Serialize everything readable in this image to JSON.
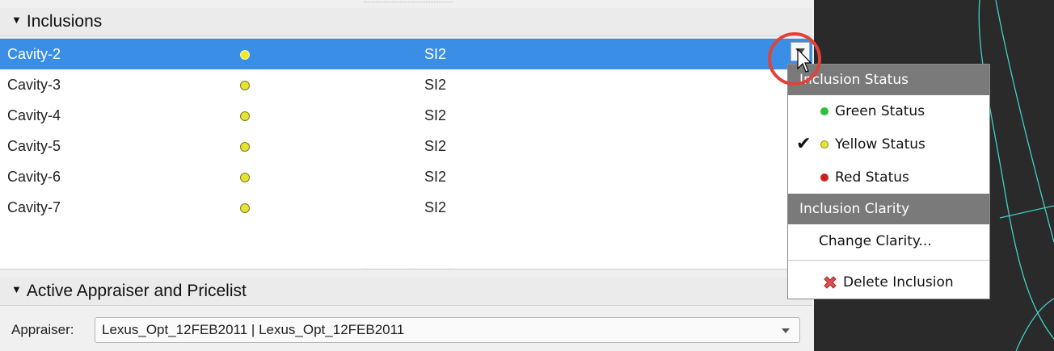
{
  "inclusions": {
    "header": "Inclusions",
    "rows": [
      {
        "name": "Cavity-2",
        "clarity": "SI2",
        "status": "yellow",
        "selected": true
      },
      {
        "name": "Cavity-3",
        "clarity": "SI2",
        "status": "yellow",
        "selected": false
      },
      {
        "name": "Cavity-4",
        "clarity": "SI2",
        "status": "yellow",
        "selected": false
      },
      {
        "name": "Cavity-5",
        "clarity": "SI2",
        "status": "yellow",
        "selected": false
      },
      {
        "name": "Cavity-6",
        "clarity": "SI2",
        "status": "yellow",
        "selected": false
      },
      {
        "name": "Cavity-7",
        "clarity": "SI2",
        "status": "yellow",
        "selected": false
      }
    ]
  },
  "appraiser_section": {
    "header": "Active Appraiser and Pricelist",
    "appraiser_label": "Appraiser:",
    "appraiser_value": "Lexus_Opt_12FEB2011 | Lexus_Opt_12FEB2011"
  },
  "context_menu": {
    "status_header": "Inclusion Status",
    "green_label": "Green Status",
    "yellow_label": "Yellow Status",
    "red_label": "Red Status",
    "clarity_header": "Inclusion Clarity",
    "change_clarity_label": "Change Clarity...",
    "delete_label": "Delete Inclusion",
    "checked": "yellow"
  },
  "colors": {
    "selection": "#3a8ee6",
    "green": "#2fbf3a",
    "yellow": "#e7e330",
    "red": "#cc1f1f",
    "highlight_circle": "#e0433a"
  },
  "icons": {
    "collapse": "triangle-down-icon",
    "status": "status-dot-icon",
    "check": "checkmark-icon",
    "delete": "red-x-icon",
    "dropdown": "chevron-down-icon"
  }
}
